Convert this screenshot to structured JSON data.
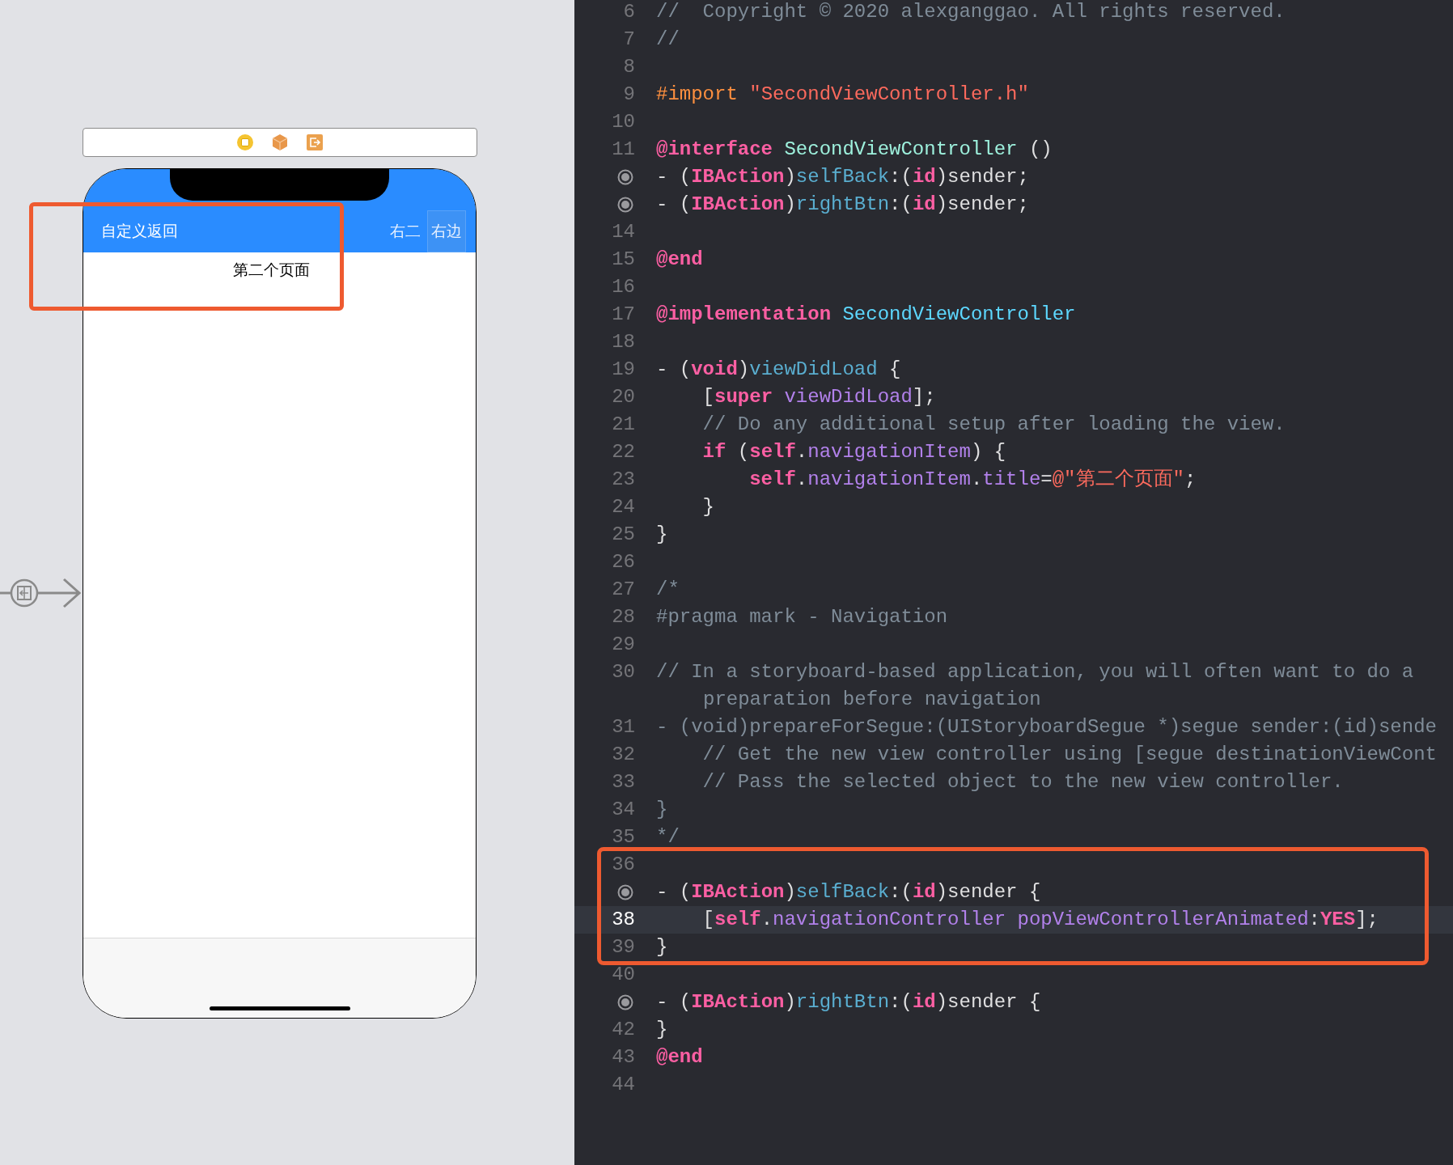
{
  "storyboard": {
    "nav_bar": {
      "left_button": "自定义返回",
      "right_buttons": [
        {
          "label": "右二",
          "selected": false
        },
        {
          "label": "右边",
          "selected": true
        }
      ]
    },
    "page_label": "第二个页面"
  },
  "editor": {
    "lines": [
      {
        "kind": "number",
        "number": "6",
        "current": false,
        "tokens": [
          {
            "kind": "comment",
            "text": "//  Copyright © 2020 alexganggao. All rights reserved."
          }
        ]
      },
      {
        "kind": "number",
        "number": "7",
        "current": false,
        "tokens": [
          {
            "kind": "comment",
            "text": "//"
          }
        ]
      },
      {
        "kind": "number",
        "number": "8",
        "current": false
      },
      {
        "kind": "number",
        "number": "9",
        "current": false,
        "tokens": [
          {
            "kind": "preproc",
            "text": "#import"
          },
          {
            "kind": "string",
            "text": " \"SecondViewController.h\""
          }
        ]
      },
      {
        "kind": "number",
        "number": "10",
        "current": false
      },
      {
        "kind": "number",
        "number": "11",
        "current": false,
        "tokens": [
          {
            "kind": "keyword",
            "text": "@interface"
          },
          {
            "kind": "class-name",
            "text": " SecondViewController"
          },
          {
            "kind": "plain",
            "text": " ()"
          }
        ]
      },
      {
        "kind": "connection",
        "current": false,
        "tokens": [
          {
            "kind": "plain",
            "text": "- ("
          },
          {
            "kind": "keyword",
            "text": "IBAction"
          },
          {
            "kind": "plain",
            "text": ")"
          },
          {
            "kind": "method",
            "text": "selfBack"
          },
          {
            "kind": "plain",
            "text": ":("
          },
          {
            "kind": "keyword",
            "text": "id"
          },
          {
            "kind": "plain",
            "text": ")sender;"
          }
        ]
      },
      {
        "kind": "connection",
        "current": false,
        "tokens": [
          {
            "kind": "plain",
            "text": "- ("
          },
          {
            "kind": "keyword",
            "text": "IBAction"
          },
          {
            "kind": "plain",
            "text": ")"
          },
          {
            "kind": "method",
            "text": "rightBtn"
          },
          {
            "kind": "plain",
            "text": ":("
          },
          {
            "kind": "keyword",
            "text": "id"
          },
          {
            "kind": "plain",
            "text": ")sender;"
          }
        ]
      },
      {
        "kind": "number",
        "number": "14",
        "current": false
      },
      {
        "kind": "number",
        "number": "15",
        "current": false,
        "tokens": [
          {
            "kind": "keyword",
            "text": "@end"
          }
        ]
      },
      {
        "kind": "number",
        "number": "16",
        "current": false
      },
      {
        "kind": "number",
        "number": "17",
        "current": false,
        "tokens": [
          {
            "kind": "keyword",
            "text": "@implementation"
          },
          {
            "kind": "class-decl",
            "text": " SecondViewController"
          }
        ]
      },
      {
        "kind": "number",
        "number": "18",
        "current": false
      },
      {
        "kind": "number",
        "number": "19",
        "current": false,
        "tokens": [
          {
            "kind": "plain",
            "text": "- ("
          },
          {
            "kind": "keyword",
            "text": "void"
          },
          {
            "kind": "plain",
            "text": ")"
          },
          {
            "kind": "method",
            "text": "viewDidLoad"
          },
          {
            "kind": "plain",
            "text": " {"
          }
        ]
      },
      {
        "kind": "number",
        "number": "20",
        "current": false,
        "tokens": [
          {
            "kind": "plain",
            "text": "    ["
          },
          {
            "kind": "keyword",
            "text": "super"
          },
          {
            "kind": "member",
            "text": " viewDidLoad"
          },
          {
            "kind": "plain",
            "text": "];"
          }
        ]
      },
      {
        "kind": "number",
        "number": "21",
        "current": false,
        "tokens": [
          {
            "kind": "comment",
            "text": "    // Do any additional setup after loading the view."
          }
        ]
      },
      {
        "kind": "number",
        "number": "22",
        "current": false,
        "tokens": [
          {
            "kind": "keyword",
            "text": "    if"
          },
          {
            "kind": "plain",
            "text": " ("
          },
          {
            "kind": "keyword",
            "text": "self"
          },
          {
            "kind": "plain",
            "text": "."
          },
          {
            "kind": "member",
            "text": "navigationItem"
          },
          {
            "kind": "plain",
            "text": ") {"
          }
        ]
      },
      {
        "kind": "number",
        "number": "23",
        "current": false,
        "tokens": [
          {
            "kind": "keyword",
            "text": "        self"
          },
          {
            "kind": "plain",
            "text": "."
          },
          {
            "kind": "member",
            "text": "navigationItem"
          },
          {
            "kind": "plain",
            "text": "."
          },
          {
            "kind": "member",
            "text": "title"
          },
          {
            "kind": "plain",
            "text": "="
          },
          {
            "kind": "string",
            "text": "@\"第二个页面\""
          },
          {
            "kind": "plain",
            "text": ";"
          }
        ]
      },
      {
        "kind": "number",
        "number": "24",
        "current": false,
        "tokens": [
          {
            "kind": "plain",
            "text": "    }"
          }
        ]
      },
      {
        "kind": "number",
        "number": "25",
        "current": false,
        "tokens": [
          {
            "kind": "plain",
            "text": "}"
          }
        ]
      },
      {
        "kind": "number",
        "number": "26",
        "current": false
      },
      {
        "kind": "number",
        "number": "27",
        "current": false,
        "tokens": [
          {
            "kind": "comment",
            "text": "/*"
          }
        ]
      },
      {
        "kind": "number",
        "number": "28",
        "current": false,
        "tokens": [
          {
            "kind": "comment",
            "text": "#pragma mark - Navigation"
          }
        ]
      },
      {
        "kind": "number",
        "number": "29",
        "current": false
      },
      {
        "kind": "number",
        "number": "30",
        "current": false,
        "tokens": [
          {
            "kind": "comment",
            "text": "// In a storyboard-based application, you will often want to do a"
          }
        ],
        "wrapped": "preparation before navigation"
      },
      {
        "kind": "number",
        "number": "31",
        "current": false,
        "tokens": [
          {
            "kind": "comment",
            "text": "- (void)prepareForSegue:(UIStoryboardSegue *)segue sender:(id)sende"
          }
        ]
      },
      {
        "kind": "number",
        "number": "32",
        "current": false,
        "tokens": [
          {
            "kind": "comment",
            "text": "    // Get the new view controller using [segue destinationViewCont"
          }
        ]
      },
      {
        "kind": "number",
        "number": "33",
        "current": false,
        "tokens": [
          {
            "kind": "comment",
            "text": "    // Pass the selected object to the new view controller."
          }
        ]
      },
      {
        "kind": "number",
        "number": "34",
        "current": false,
        "tokens": [
          {
            "kind": "comment",
            "text": "}"
          }
        ]
      },
      {
        "kind": "number",
        "number": "35",
        "current": false,
        "tokens": [
          {
            "kind": "comment",
            "text": "*/"
          }
        ]
      },
      {
        "kind": "number",
        "number": "36",
        "current": false
      },
      {
        "kind": "connection",
        "current": false,
        "tokens": [
          {
            "kind": "plain",
            "text": "- ("
          },
          {
            "kind": "keyword",
            "text": "IBAction"
          },
          {
            "kind": "plain",
            "text": ")"
          },
          {
            "kind": "method",
            "text": "selfBack"
          },
          {
            "kind": "plain",
            "text": ":("
          },
          {
            "kind": "keyword",
            "text": "id"
          },
          {
            "kind": "plain",
            "text": ")sender {"
          }
        ]
      },
      {
        "kind": "number",
        "number": "38",
        "current": true,
        "tokens": [
          {
            "kind": "plain",
            "text": "    ["
          },
          {
            "kind": "keyword",
            "text": "self"
          },
          {
            "kind": "plain",
            "text": "."
          },
          {
            "kind": "member",
            "text": "navigationController"
          },
          {
            "kind": "member",
            "text": " popViewControllerAnimated"
          },
          {
            "kind": "plain",
            "text": ":"
          },
          {
            "kind": "keyword",
            "text": "YES"
          },
          {
            "kind": "plain",
            "text": "];"
          }
        ]
      },
      {
        "kind": "number",
        "number": "39",
        "current": false,
        "tokens": [
          {
            "kind": "plain",
            "text": "}"
          }
        ]
      },
      {
        "kind": "number",
        "number": "40",
        "current": false
      },
      {
        "kind": "connection",
        "current": false,
        "tokens": [
          {
            "kind": "plain",
            "text": "- ("
          },
          {
            "kind": "keyword",
            "text": "IBAction"
          },
          {
            "kind": "plain",
            "text": ")"
          },
          {
            "kind": "method",
            "text": "rightBtn"
          },
          {
            "kind": "plain",
            "text": ":("
          },
          {
            "kind": "keyword",
            "text": "id"
          },
          {
            "kind": "plain",
            "text": ")sender {"
          }
        ]
      },
      {
        "kind": "number",
        "number": "42",
        "current": false,
        "tokens": [
          {
            "kind": "plain",
            "text": "}"
          }
        ]
      },
      {
        "kind": "number",
        "number": "43",
        "current": false,
        "tokens": [
          {
            "kind": "keyword",
            "text": "@end"
          }
        ]
      },
      {
        "kind": "number",
        "number": "44",
        "current": false
      }
    ]
  }
}
